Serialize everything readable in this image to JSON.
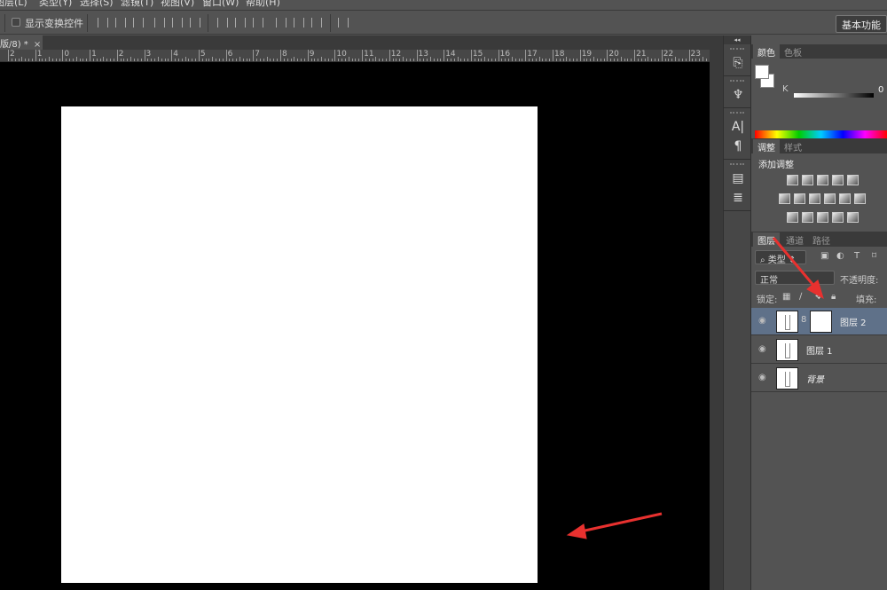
{
  "menu": [
    "图层(L)",
    "类型(Y)",
    "选择(S)",
    "滤镜(T)",
    "视图(V)",
    "窗口(W)",
    "帮助(H)"
  ],
  "options": {
    "show_transform_label": "显示变换控件",
    "workspace_label": "基本功能"
  },
  "document": {
    "tab_title": "版/8) *",
    "close": "×"
  },
  "ruler": {
    "labels": [
      "2",
      "1",
      "0",
      "1",
      "2",
      "3",
      "4",
      "5",
      "6",
      "7",
      "8",
      "9",
      "10",
      "11",
      "12",
      "13",
      "14",
      "15",
      "16",
      "17",
      "18",
      "19",
      "20",
      "21",
      "22",
      "23"
    ]
  },
  "dock": {
    "collapse": "◂◂"
  },
  "color_panel": {
    "tabs": [
      "颜色",
      "色板"
    ],
    "channel": "K",
    "value": "0"
  },
  "adjust_panel": {
    "tabs": [
      "调整",
      "样式"
    ],
    "title": "添加调整"
  },
  "layers_panel": {
    "tabs": [
      "图层",
      "通道",
      "路径"
    ],
    "filter": "类型",
    "blend_mode": "正常",
    "opacity_label": "不透明度:",
    "lock_label": "锁定:",
    "fill_label": "填充:",
    "layers": [
      {
        "name": "图层 2",
        "selected": true,
        "mask": true
      },
      {
        "name": "图层 1",
        "selected": false
      },
      {
        "name": "背景",
        "selected": false
      }
    ]
  },
  "annotation_color": "#e8312f"
}
